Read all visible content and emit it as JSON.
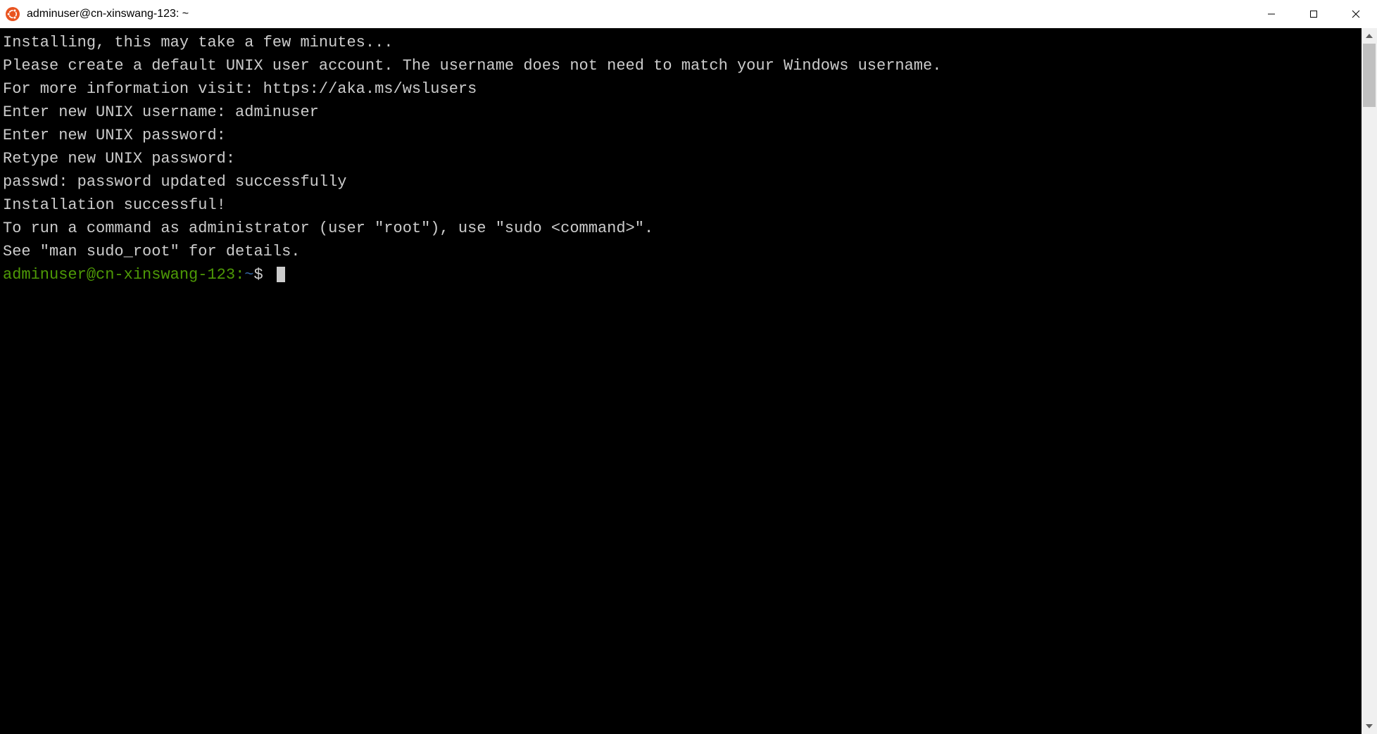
{
  "window": {
    "title": "adminuser@cn-xinswang-123: ~"
  },
  "terminal": {
    "lines": [
      "Installing, this may take a few minutes...",
      "Please create a default UNIX user account. The username does not need to match your Windows username.",
      "For more information visit: https://aka.ms/wslusers",
      "Enter new UNIX username: adminuser",
      "Enter new UNIX password:",
      "Retype new UNIX password:",
      "passwd: password updated successfully",
      "Installation successful!",
      "To run a command as administrator (user \"root\"), use \"sudo <command>\".",
      "See \"man sudo_root\" for details.",
      ""
    ],
    "prompt": {
      "user_host": "adminuser@cn-xinswang-123",
      "colon": ":",
      "path": "~",
      "symbol": "$ "
    }
  }
}
